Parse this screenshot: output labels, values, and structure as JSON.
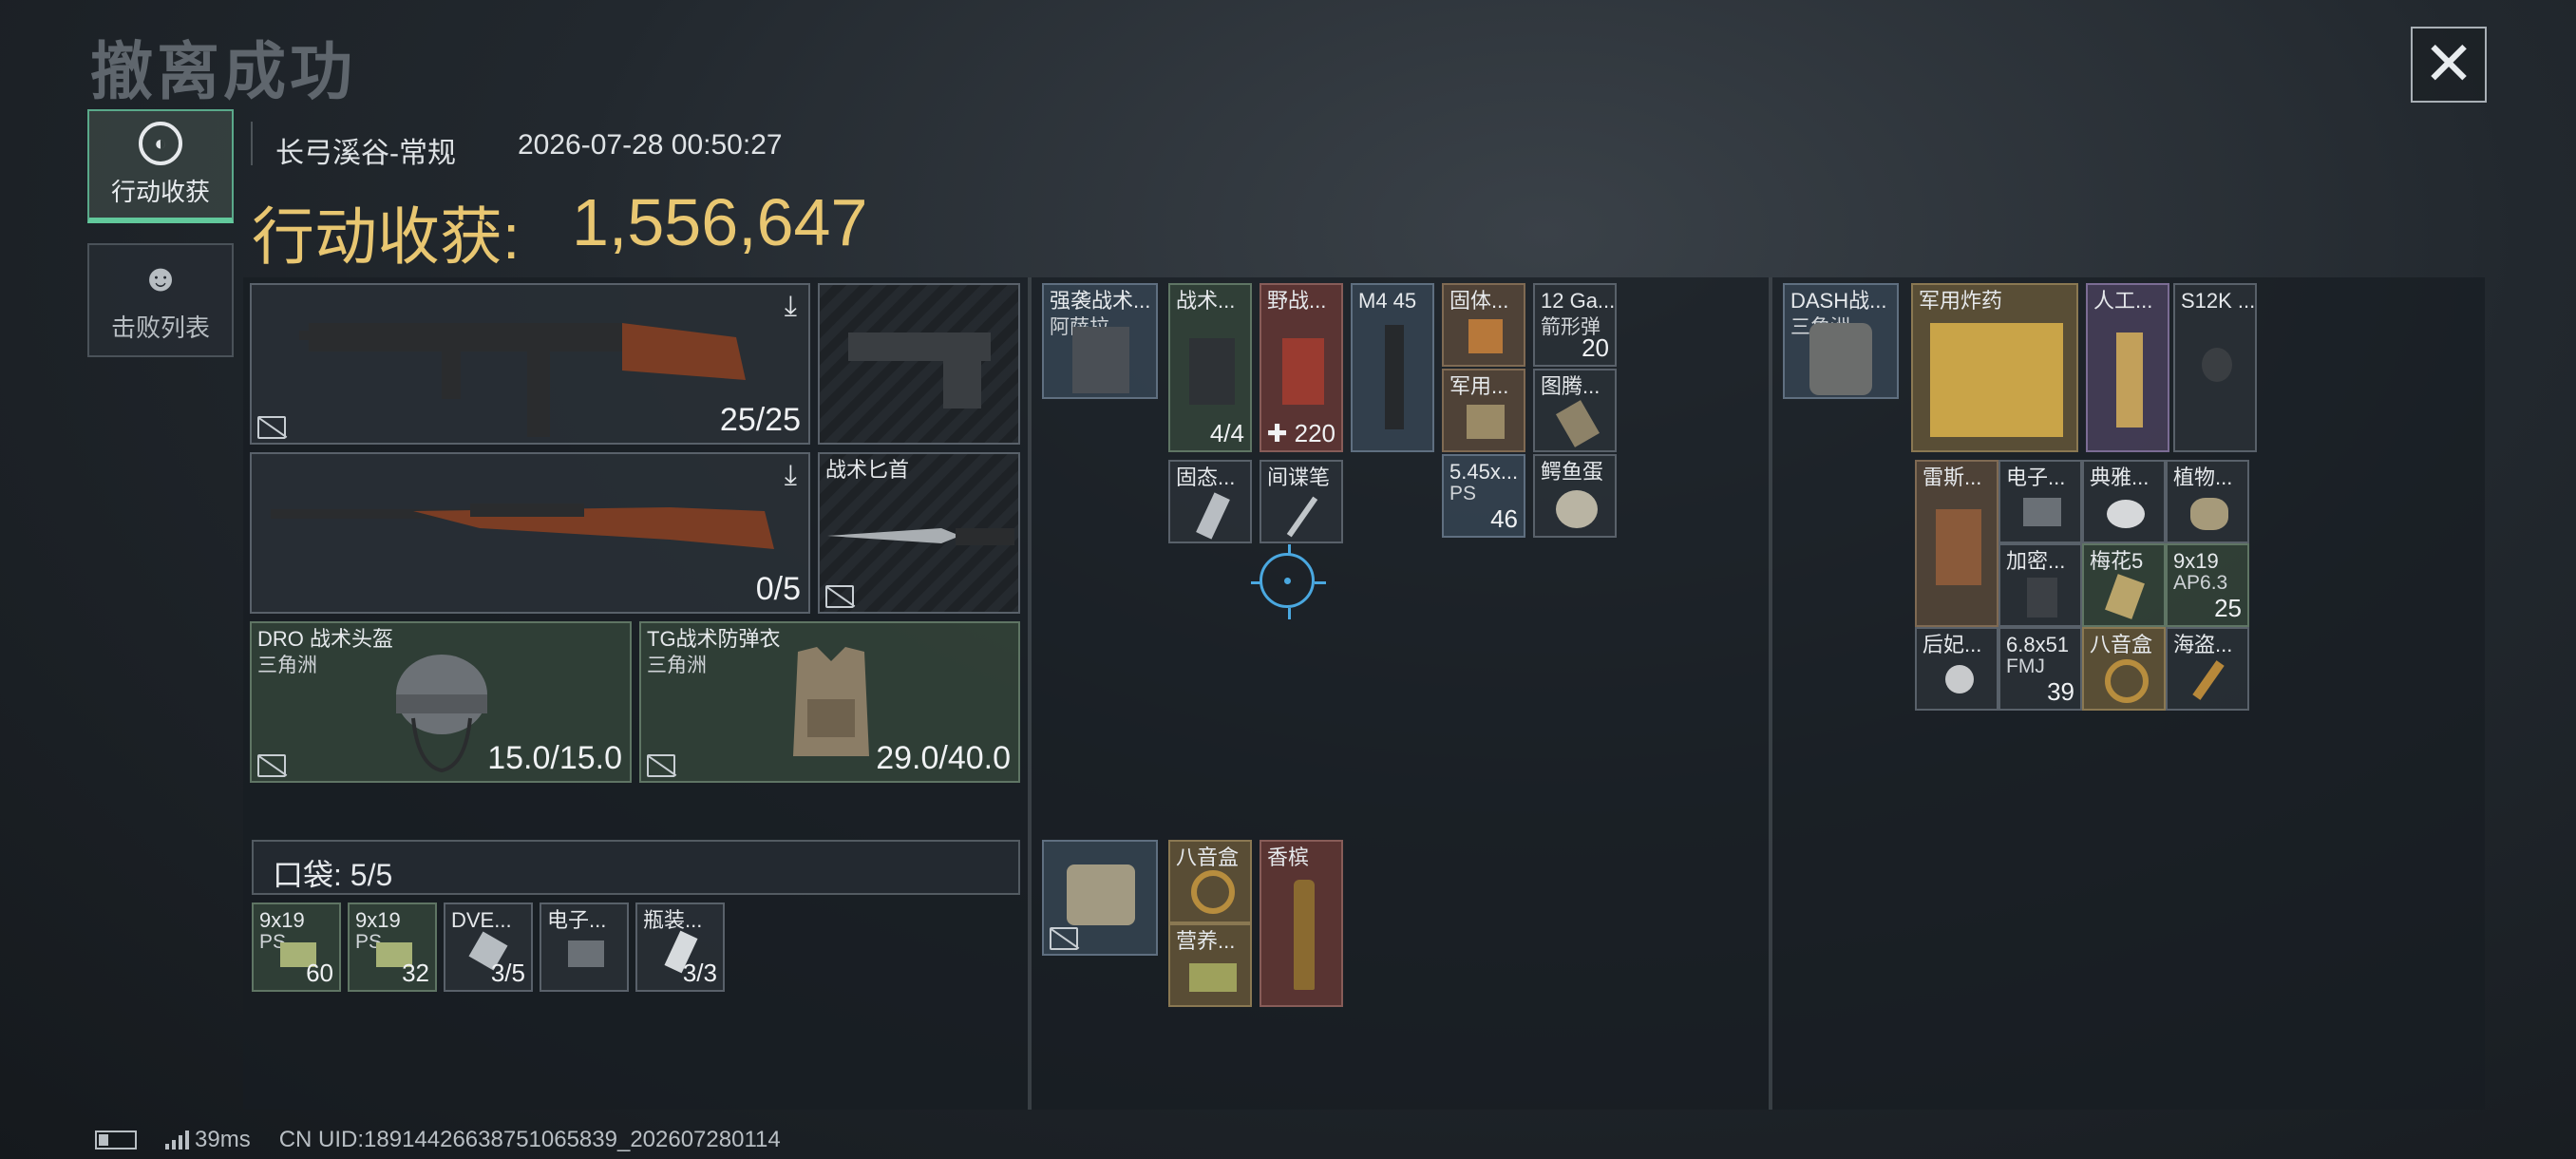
{
  "header": {
    "title": "撤离成功",
    "close_icon": "close-icon"
  },
  "tabs": [
    {
      "label": "行动收获",
      "icon": "loot-icon",
      "active": true
    },
    {
      "label": "击败列表",
      "icon": "skull-icon",
      "active": false
    }
  ],
  "match": {
    "map": "长弓溪谷-常规",
    "datetime": "2026-07-28 00:50:27",
    "earnings_label": "行动收获:",
    "earnings_value": "1,556,647"
  },
  "loadout": {
    "primary_ammo": "25/25",
    "secondary_ammo": "0/5",
    "melee_name": "战术匕首",
    "helmet_name": "DRO 战术头盔",
    "helmet_sub": "三角洲",
    "helmet_durability": "15.0/15.0",
    "armor_name": "TG战术防弹衣",
    "armor_sub": "三角洲",
    "armor_durability": "29.0/40.0",
    "pocket_label": "口袋:",
    "pocket_value": "5/5"
  },
  "pocket_items": [
    {
      "name": "9x19",
      "sub": "PS...",
      "count": "60"
    },
    {
      "name": "9x19",
      "sub": "PS...",
      "count": "32"
    },
    {
      "name": "DVE...",
      "count": "3/5"
    },
    {
      "name": "电子...",
      "count": ""
    },
    {
      "name": "瓶装...",
      "count": "3/3"
    }
  ],
  "rig": {
    "name": "强袭战术...",
    "sub": "阿萨拉"
  },
  "rig_items": [
    {
      "name": "战术...",
      "count": "4/4"
    },
    {
      "name": "野战...",
      "count": "✚ 220"
    },
    {
      "name": "M4 45",
      "count": ""
    },
    {
      "name": "固体...",
      "count": ""
    },
    {
      "name": "12 Ga...",
      "sub": "箭形弹",
      "count": "20"
    },
    {
      "name": "军用...",
      "count": ""
    },
    {
      "name": "图腾...",
      "count": ""
    },
    {
      "name": "固态...",
      "count": ""
    },
    {
      "name": "间谍笔",
      "count": ""
    },
    {
      "name": "5.45x...",
      "sub": "PS",
      "count": "46"
    },
    {
      "name": "鳄鱼蛋",
      "count": ""
    }
  ],
  "case_items": [
    {
      "name": "八音盒",
      "count": ""
    },
    {
      "name": "香槟",
      "count": ""
    },
    {
      "name": "营养...",
      "count": ""
    }
  ],
  "backpack": {
    "name": "DASH战...",
    "sub": "三角洲"
  },
  "backpack_items": [
    {
      "name": "军用炸药",
      "count": ""
    },
    {
      "name": "人工...",
      "count": ""
    },
    {
      "name": "S12K ...",
      "count": ""
    },
    {
      "name": "雷斯...",
      "count": ""
    },
    {
      "name": "电子...",
      "count": ""
    },
    {
      "name": "典雅...",
      "count": ""
    },
    {
      "name": "植物...",
      "count": ""
    },
    {
      "name": "加密...",
      "count": ""
    },
    {
      "name": "梅花5",
      "count": ""
    },
    {
      "name": "9x19",
      "sub": "AP6.3",
      "count": "25"
    },
    {
      "name": "后妃...",
      "count": ""
    },
    {
      "name": "6.8x51",
      "sub": "FMJ",
      "count": "39"
    },
    {
      "name": "八音盒",
      "count": ""
    },
    {
      "name": "海盗...",
      "count": ""
    }
  ],
  "status": {
    "ping": "39ms",
    "uid": "CN UID:18914426638751065839_202607280114"
  }
}
